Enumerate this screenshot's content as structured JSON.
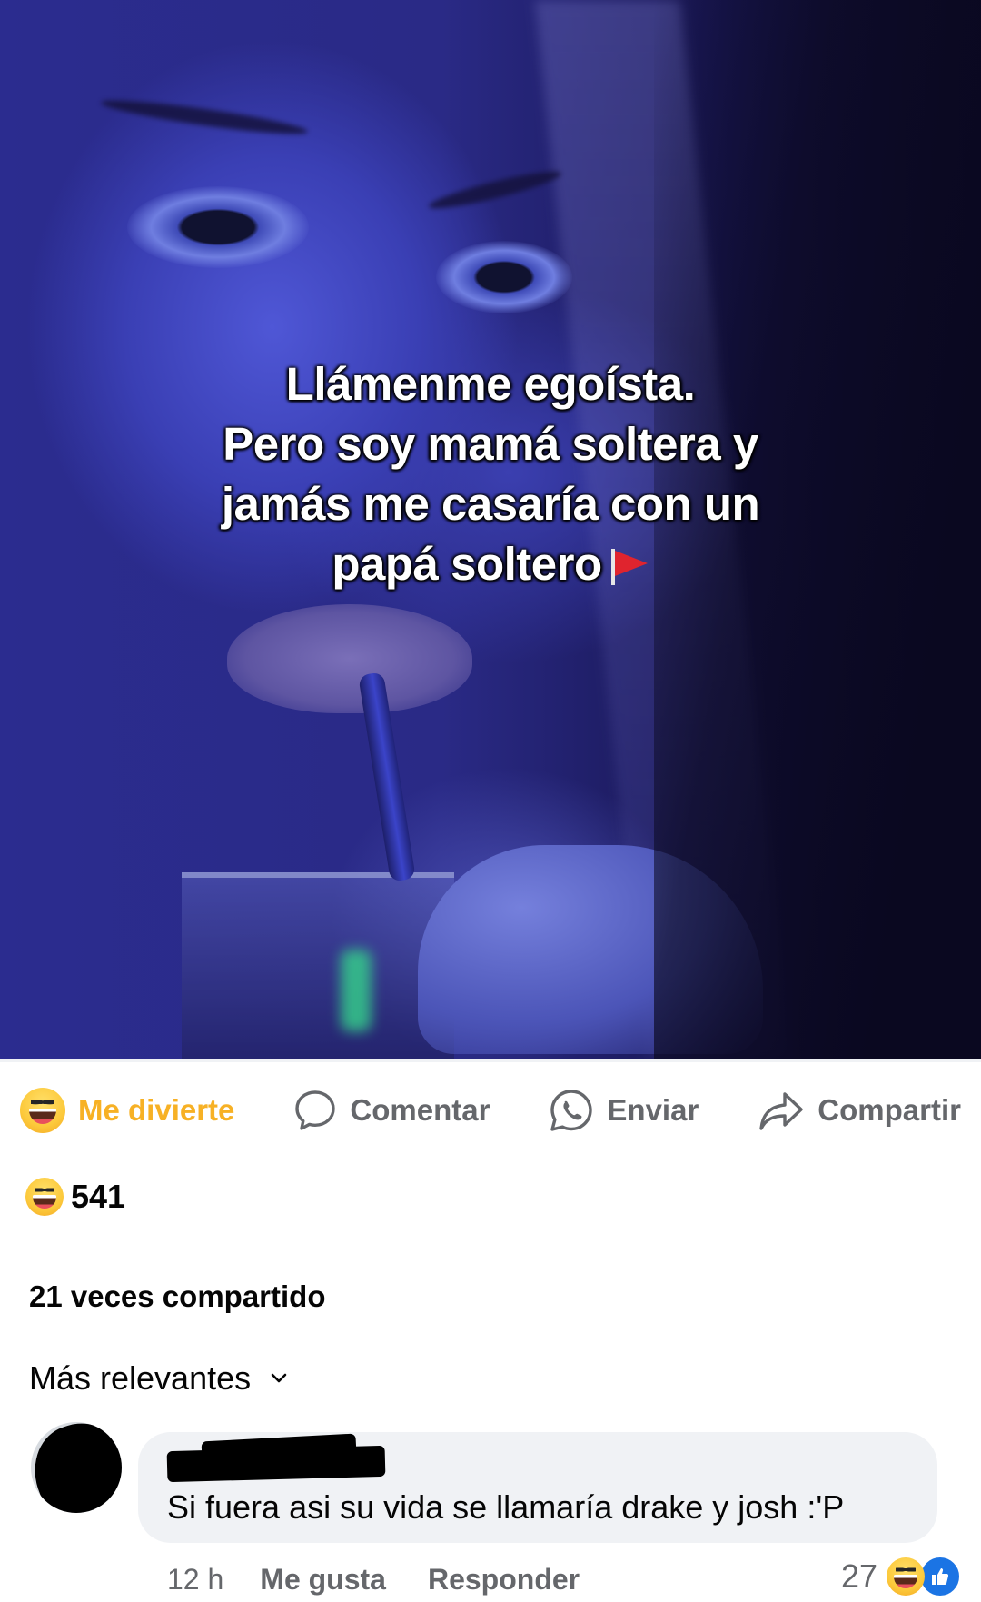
{
  "post": {
    "caption_lines": [
      "Llámenme egoísta.",
      "Pero soy mamá soltera y",
      "jamás me casaría  con un",
      "papá soltero"
    ],
    "caption_emoji": "red-flag-icon"
  },
  "actions": {
    "react_label": "Me divierte",
    "comment_label": "Comentar",
    "send_label": "Enviar",
    "share_label": "Compartir",
    "active_color": "#f7b125",
    "muted_color": "#65676b"
  },
  "stats": {
    "reaction_count": "541",
    "shares_text": "21 veces compartido"
  },
  "comments_section": {
    "sort_label": "Más relevantes"
  },
  "comment": {
    "text": "Si fuera asi su vida se llamaría drake y josh :'P",
    "time": "12 h",
    "like_label": "Me gusta",
    "reply_label": "Responder",
    "reaction_count": "27"
  },
  "colors": {
    "like_blue": "#1b74e4",
    "bubble_bg": "#f0f2f5"
  }
}
